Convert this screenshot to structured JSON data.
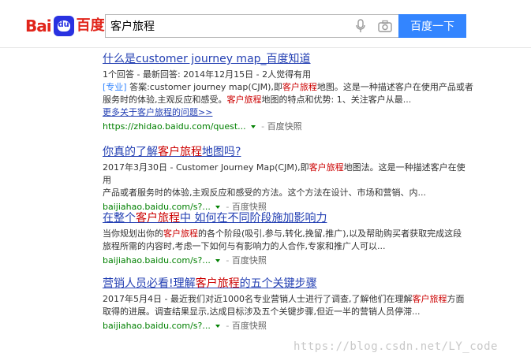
{
  "logo": {
    "bai": "Bai",
    "du": "du",
    "baidu_cn": "百度"
  },
  "search": {
    "query": "客户旅程",
    "button_label": "百度一下"
  },
  "results": [
    {
      "title_pre": "什么是customer journey map_百度知道",
      "meta": "1个回答 - 最新回答: 2014年12月15日 - 2人觉得有用",
      "tag": "[专业]",
      "abs1_pre": " 答案:customer journey map(CJM),即",
      "abs1_em": "客户旅程",
      "abs1_post": "地图。这是一种描述客户在使用产品或者",
      "abs2_pre": "服务时的体验,主观反应和感受。",
      "abs2_em": "客户旅程",
      "abs2_post": "地图的特点和优势: 1、关注客户从最...",
      "more": "更多关于客户旅程的问题>>",
      "url": "https://zhidao.baidu.com/quest...",
      "snap": "百度快照"
    },
    {
      "title_pre": "你真的了解",
      "title_em": "客户旅程",
      "title_post": "地图吗?",
      "abs1_pre": "2017年3月30日 - Customer Journey Map(CJM),即",
      "abs1_em": "客户旅程",
      "abs1_post": "地图法。这是一种描述客户在使用",
      "abs2_pre": "产品或者服务时的体验,主观反应和感受的方法。这个方法在设计、市场和营销、内...",
      "url": "baijiahao.baidu.com/s?...",
      "snap": "百度快照"
    },
    {
      "title_pre": "在整个",
      "title_em": "客户旅程",
      "title_post": "中 如何在不同阶段施加影响力",
      "abs1_pre": "当你规划出你的",
      "abs1_em": "客户旅程",
      "abs1_post": "的各个阶段(吸引,参与,转化,挽留,推广),以及帮助购买者获取完成这段",
      "abs2_pre": "旅程所需的内容时,考虑一下如何与有影响力的人合作,专家和推广人可以...",
      "url": "baijiahao.baidu.com/s?...",
      "snap": "百度快照"
    },
    {
      "title_pre": "营销人员必看!理解",
      "title_em": "客户旅程",
      "title_post": "的五个关键步骤",
      "abs1_pre": "2017年5月4日 - 最近我们对近1000名专业营销人士进行了调查,了解他们在理解",
      "abs1_em": "客户旅程",
      "abs1_post": "方面",
      "abs2_pre": "取得的进展。调查结果显示,达成目标涉及五个关键步骤,但近一半的营销人员停滞...",
      "url": "baijiahao.baidu.com/s?...",
      "snap": "百度快照"
    }
  ],
  "separator": " - ",
  "watermark": "https://blog.csdn.net/LY_code",
  "colors": {
    "link": "#2440b3",
    "highlight": "#cc0000",
    "url": "#008000",
    "button": "#3385ff",
    "logo_red": "#e1251b",
    "logo_blue": "#2932e1"
  }
}
